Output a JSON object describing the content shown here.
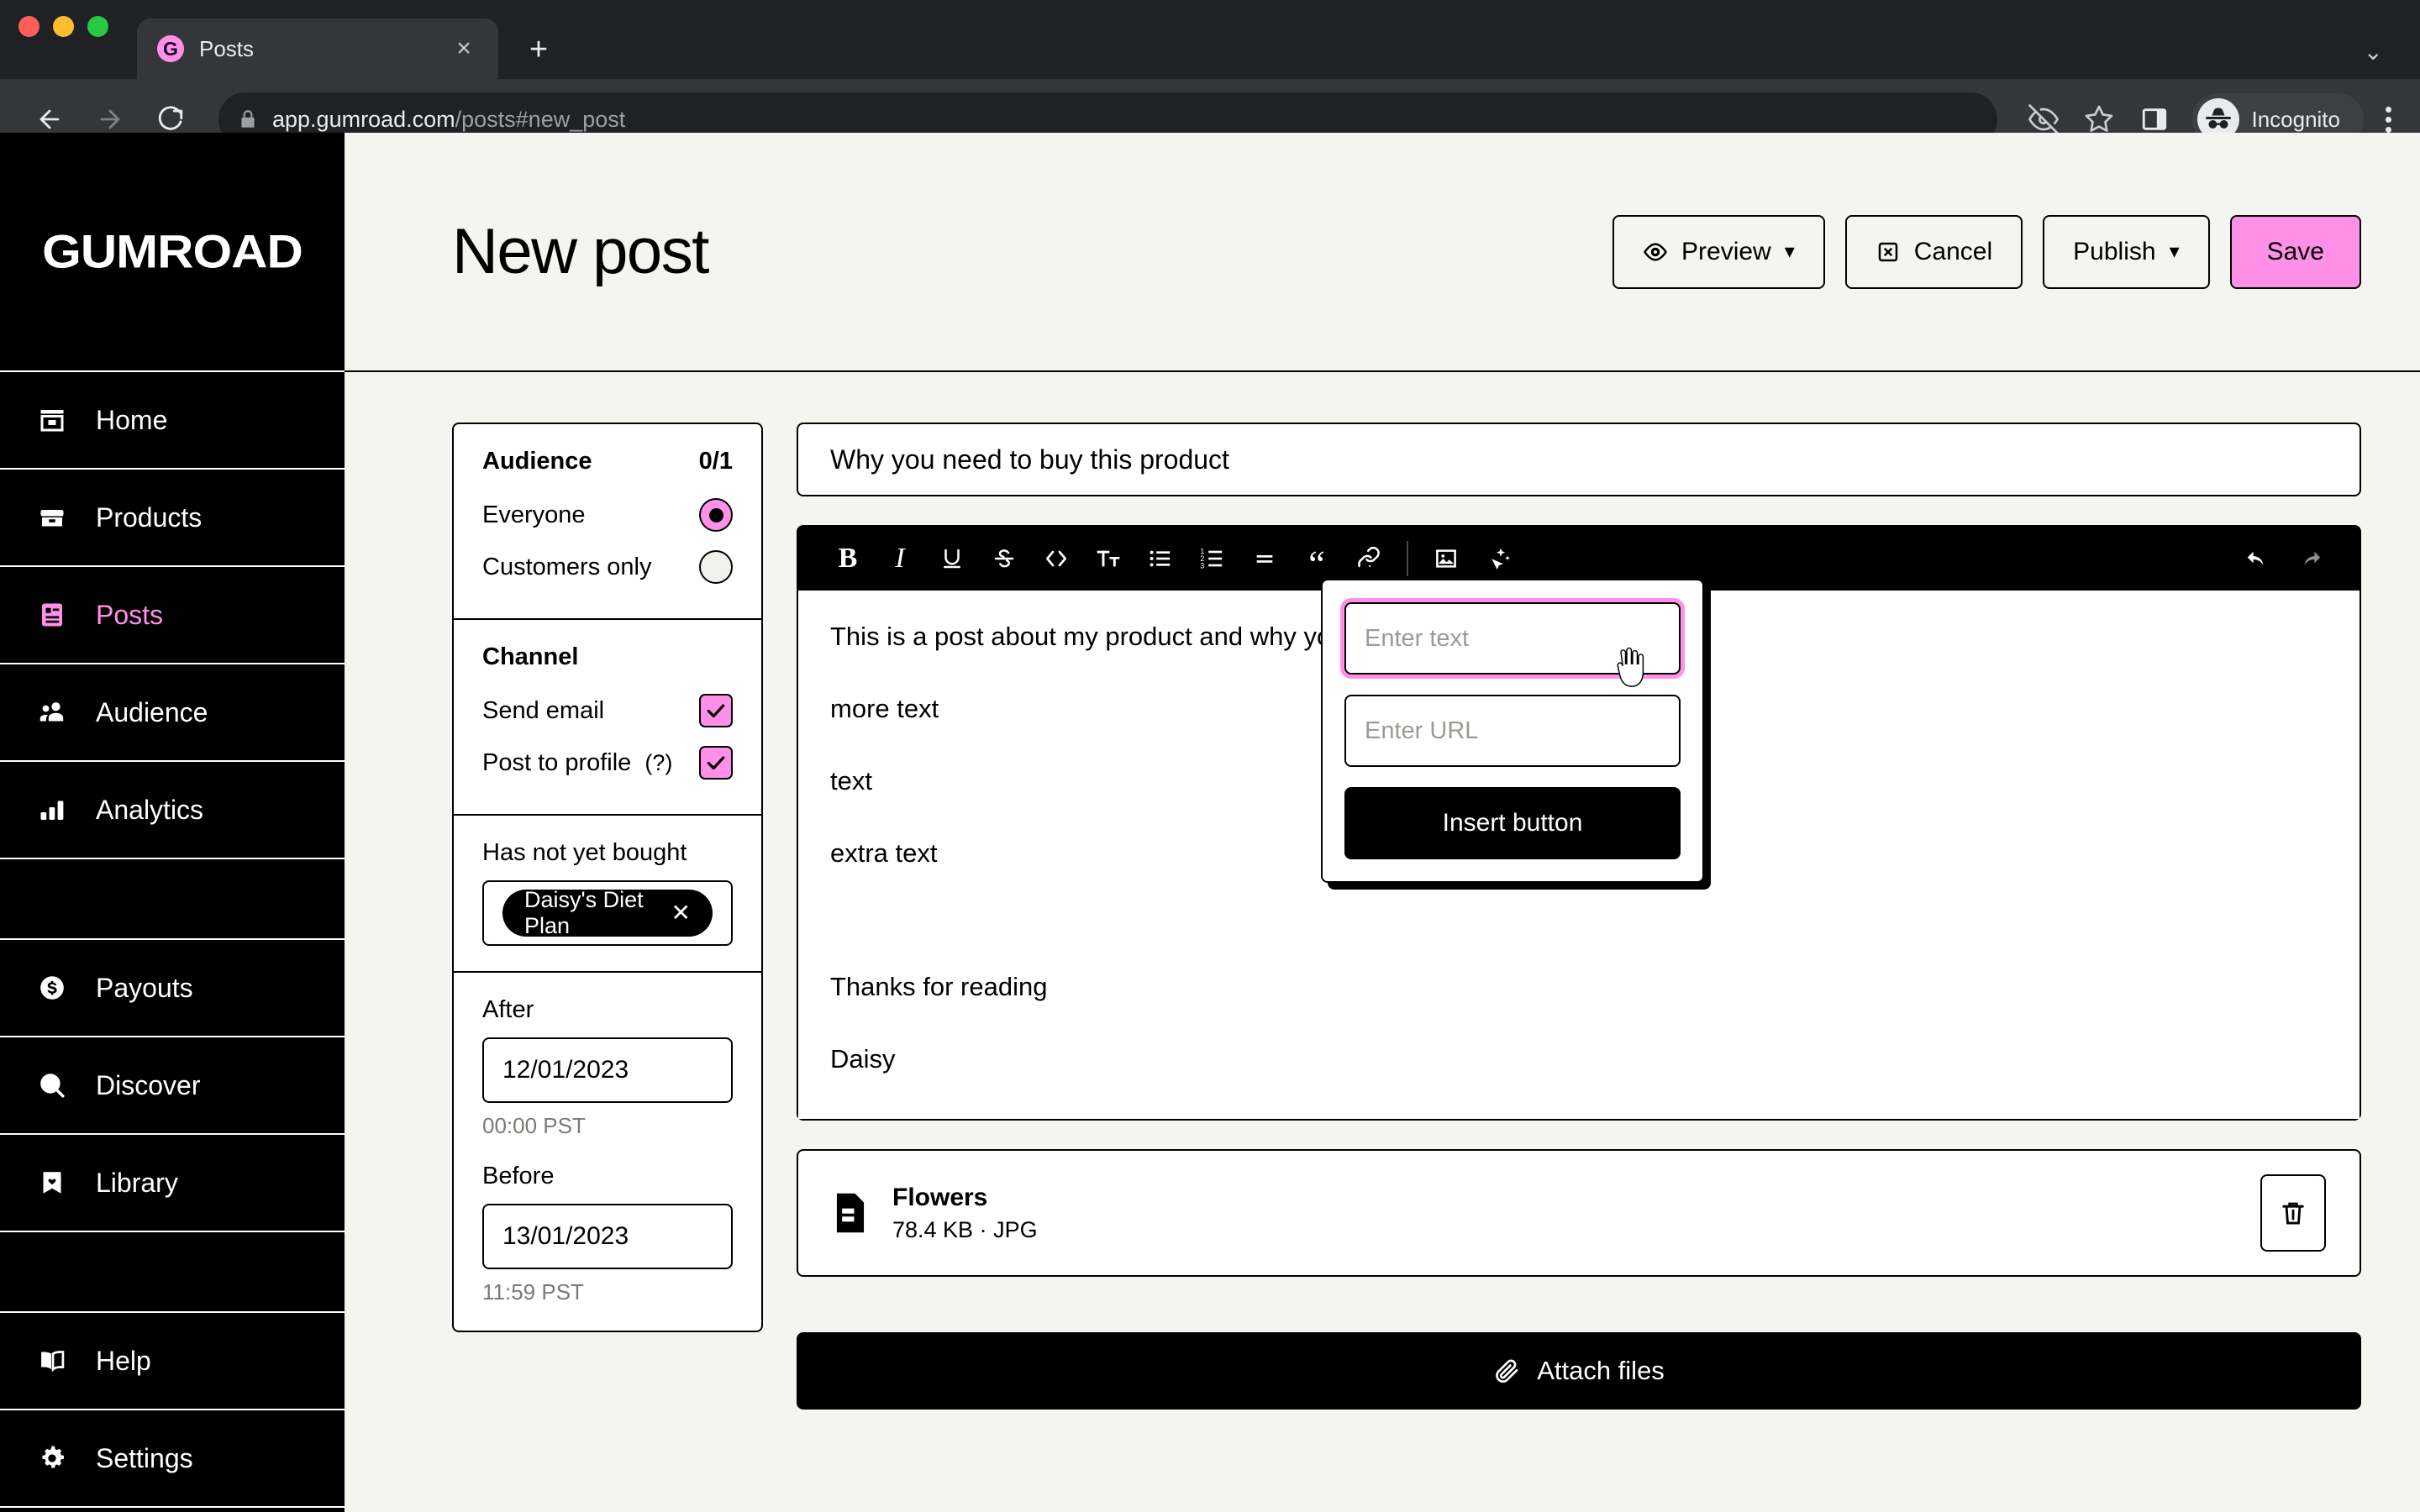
{
  "browser": {
    "tab": {
      "title": "Posts",
      "favicon_letter": "G",
      "favicon_color": "#ff90e8",
      "close_label": "×"
    },
    "new_tab_label": "+",
    "tab_list_label": "⌄",
    "url_primary": "app.gumroad.com",
    "url_secondary": "/posts#new_post",
    "profile_label": "Incognito",
    "icons": {
      "back": "back-arrow-icon",
      "forward": "forward-arrow-icon",
      "reload": "reload-icon",
      "lock": "lock-icon",
      "tracking": "eye-off-icon",
      "bookmark": "star-icon",
      "sidepanel": "side-panel-icon",
      "menu": "kebab-menu-icon"
    }
  },
  "sidebar": {
    "brand": "GUMROAD",
    "items": [
      {
        "label": "Home",
        "icon": "store-icon",
        "active": false
      },
      {
        "label": "Products",
        "icon": "box-icon",
        "active": false
      },
      {
        "label": "Posts",
        "icon": "post-icon",
        "active": true
      },
      {
        "label": "Audience",
        "icon": "people-icon",
        "active": false
      },
      {
        "label": "Analytics",
        "icon": "bar-chart-icon",
        "active": false
      },
      {
        "label": "Payouts",
        "icon": "dollar-circle-icon",
        "active": false
      },
      {
        "label": "Discover",
        "icon": "search-icon",
        "active": false
      },
      {
        "label": "Library",
        "icon": "bookmark-heart-icon",
        "active": false
      },
      {
        "label": "Help",
        "icon": "book-icon",
        "active": false
      },
      {
        "label": "Settings",
        "icon": "gear-icon",
        "active": false
      }
    ]
  },
  "header": {
    "title": "New post",
    "preview_label": "Preview",
    "cancel_label": "Cancel",
    "publish_label": "Publish",
    "save_label": "Save",
    "save_color": "#ff90e8"
  },
  "settings": {
    "audience": {
      "title": "Audience",
      "count": "0/1",
      "options": [
        {
          "label": "Everyone",
          "selected": true
        },
        {
          "label": "Customers only",
          "selected": false
        }
      ]
    },
    "channel": {
      "title": "Channel",
      "options": [
        {
          "label": "Send email",
          "checked": true,
          "help": false
        },
        {
          "label": "Post to profile",
          "checked": true,
          "help": true,
          "help_mark": "(?)"
        }
      ]
    },
    "not_bought": {
      "label": "Has not yet bought",
      "tag": "Daisy's Diet Plan",
      "tag_remove": "✕"
    },
    "dates": {
      "after_label": "After",
      "after_value": "12/01/2023",
      "after_hint": "00:00 PST",
      "before_label": "Before",
      "before_value": "13/01/2023",
      "before_hint": "11:59 PST"
    }
  },
  "editor": {
    "title_value": "Why you need to buy this product",
    "toolbar": [
      {
        "name": "bold",
        "glyph": "B"
      },
      {
        "name": "italic",
        "glyph": "I"
      },
      {
        "name": "underline",
        "glyph": "U"
      },
      {
        "name": "strikethrough",
        "glyph": "S"
      },
      {
        "name": "code",
        "glyph": "<>"
      },
      {
        "name": "text-size",
        "glyph": "Tt"
      },
      {
        "name": "bullet-list",
        "glyph": "☰"
      },
      {
        "name": "numbered-list",
        "glyph": "123"
      },
      {
        "name": "horizontal-rule",
        "glyph": "="
      },
      {
        "name": "blockquote",
        "glyph": "“"
      },
      {
        "name": "link",
        "glyph": "🔗"
      },
      {
        "name": "image",
        "glyph": "▣"
      },
      {
        "name": "insert-button",
        "glyph": "✦"
      },
      {
        "name": "undo",
        "glyph": "↶"
      },
      {
        "name": "redo",
        "glyph": "↷"
      }
    ],
    "paragraphs": [
      "This is a post about my product and why you need to buy it",
      "more text",
      "text",
      "extra text",
      "Thanks for reading",
      "Daisy"
    ]
  },
  "popover": {
    "text_placeholder": "Enter text",
    "url_placeholder": "Enter URL",
    "insert_label": "Insert button",
    "focus_color": "#ff90e8"
  },
  "attachment": {
    "file_name": "Flowers",
    "file_meta": "78.4 KB · JPG",
    "delete_icon": "trash-icon",
    "attach_label": "Attach files",
    "attach_icon": "paperclip-icon"
  }
}
